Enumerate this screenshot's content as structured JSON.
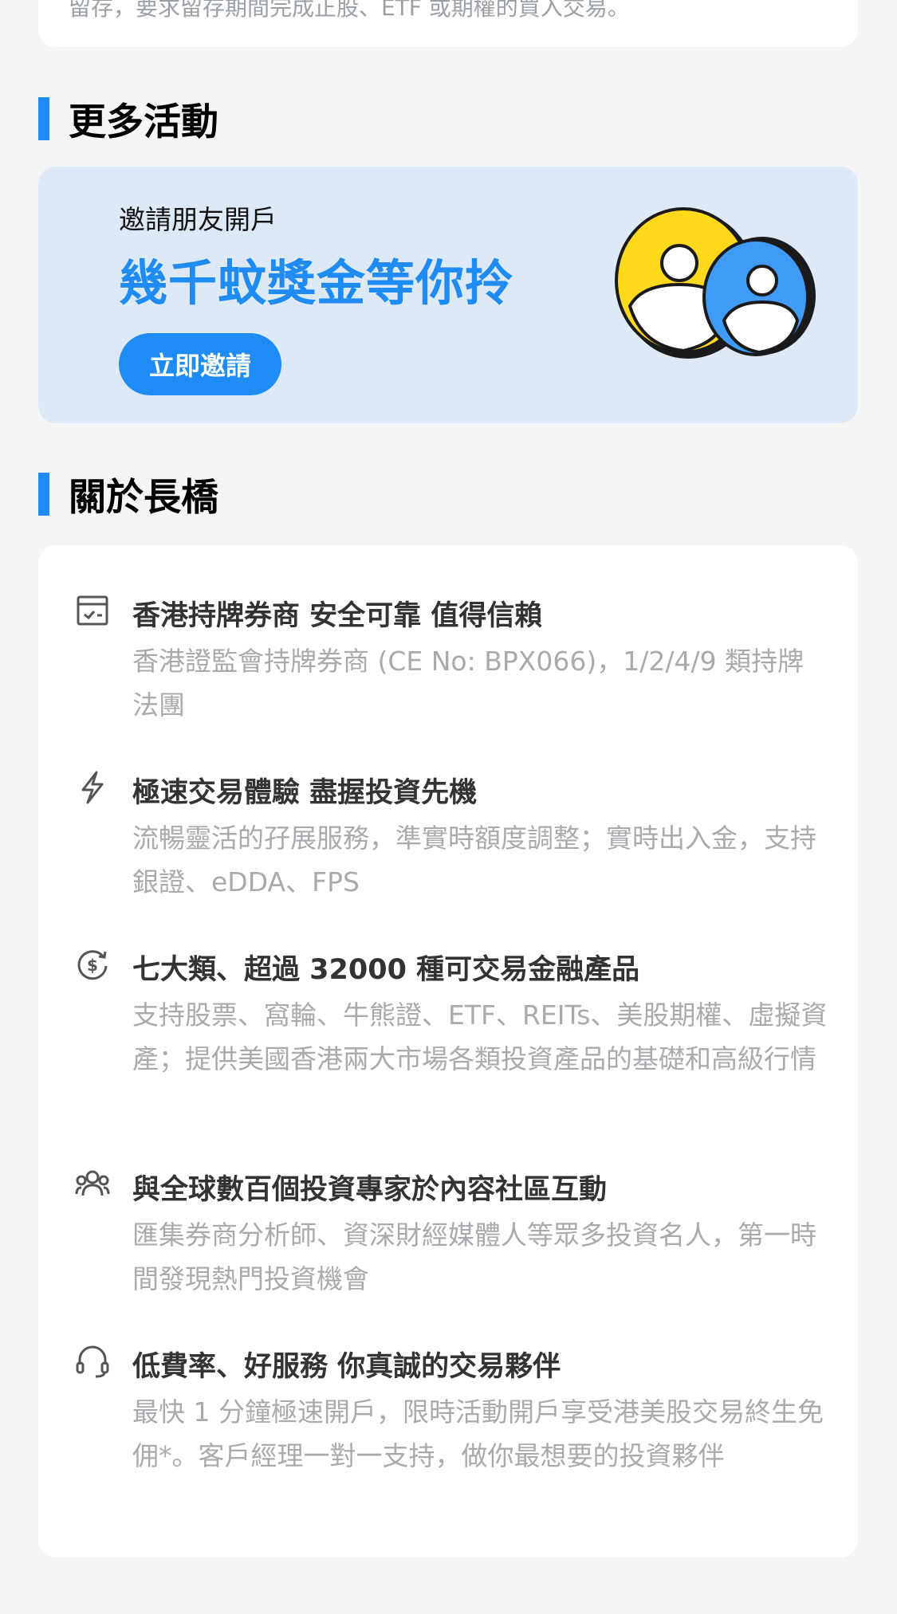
{
  "top_card": {
    "cut_text": "留存，要求留存期間完成正股、ETF 或期權的買入交易。"
  },
  "more_activities": {
    "heading": "更多活動"
  },
  "invite": {
    "subtitle": "邀請朋友開戶",
    "title": "幾千蚊獎金等你拎",
    "button_label": "立即邀請"
  },
  "about": {
    "heading": "關於長橋",
    "features": [
      {
        "icon": "license-check-icon",
        "title": "香港持牌券商 安全可靠 值得信賴",
        "desc": "香港證監會持牌券商 (CE No: BPX066)，1/2/4/9 類持牌法團"
      },
      {
        "icon": "lightning-icon",
        "title": "極速交易體驗 盡握投資先機",
        "desc": "流暢靈活的孖展服務，準實時額度調整；實時出入金，支持銀證、eDDA、FPS"
      },
      {
        "icon": "dollar-exchange-icon",
        "title": "七大類、超過 32000 種可交易金融產品",
        "desc": "支持股票、窩輪、牛熊證、ETF、REITs、美股期權、虛擬資產；提供美國香港兩大市場各類投資產品的基礎和高級行情"
      },
      {
        "icon": "community-icon",
        "title": "與全球數百個投資專家於內容社區互動",
        "desc": "匯集券商分析師、資深財經媒體人等眾多投資名人，第一時間發現熱門投資機會"
      },
      {
        "icon": "headset-icon",
        "title": "低費率、好服務 你真誠的交易夥伴",
        "desc": "最快 1 分鐘極速開戶，限時活動開戶享受港美股交易終生免佣*。客戶經理一對一支持，做你最想要的投資夥伴"
      }
    ]
  },
  "colors": {
    "accent": "#1e8cf4",
    "coin_yellow": "#ffd91a",
    "coin_blue": "#3f9bf5"
  }
}
